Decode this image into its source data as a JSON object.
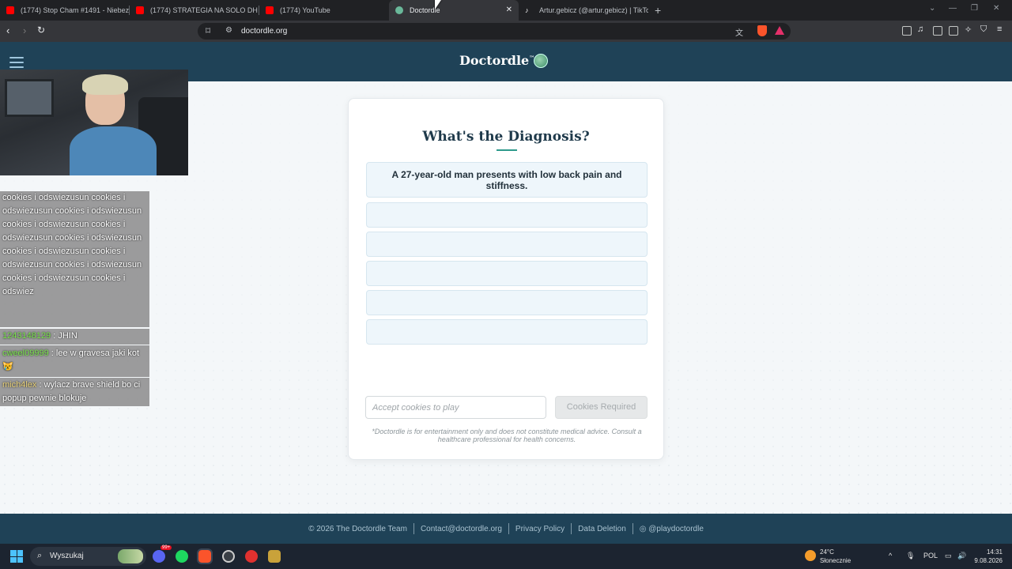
{
  "browser": {
    "tabs": [
      {
        "title": "(1774) Stop Cham #1491 - Niebezpie",
        "icon": "youtube-icon",
        "color": "#ff0000"
      },
      {
        "title": "(1774) STRATEGIA NA SOLO DH JEST",
        "icon": "youtube-icon",
        "color": "#ff0000"
      },
      {
        "title": "(1774) YouTube",
        "icon": "youtube-icon",
        "color": "#ff0000"
      },
      {
        "title": "Doctordle",
        "icon": "globe-icon",
        "color": "#6ab89a",
        "active": true
      },
      {
        "title": "Artur.gebicz (@artur.gebicz) | TikTok",
        "icon": "tiktok-icon",
        "color": "#ffffff"
      }
    ],
    "new_tab": "+",
    "url": "doctordle.org"
  },
  "site": {
    "logo": "Doctordle",
    "logo_tm": "™",
    "heading": "What's the Diagnosis?",
    "clues": [
      "A 27-year-old man presents with low back pain and stiffness.",
      "",
      "",
      "",
      "",
      ""
    ],
    "input_placeholder": "Accept cookies to play",
    "submit_label": "Cookies Required",
    "disclaimer": "*Doctordle is for entertainment only and does not constitute medical advice. Consult a healthcare professional for health concerns.",
    "accent": "#2e9a8c"
  },
  "footer": {
    "copyright": "© 2026 The Doctordle Team",
    "contact": "Contact@doctordle.org",
    "privacy": "Privacy Policy",
    "deletion": "Data Deletion",
    "instagram": "◎ @playdoctordle"
  },
  "chat": [
    {
      "user": "",
      "text": "cookies i odswiezusun cookies i odswiezusun cookies i odswiezusun cookies i odswiezusun cookies i odswiezusun cookies i odswiezusun cookies i odswiezusun cookies i odswiezusun cookies i odswiezusun cookies i odswiezusun cookies i odswiez"
    },
    {
      "user": "1243148129",
      "text": " : JHIN"
    },
    {
      "user": "cweel09999",
      "text": " : lee w gravesa jaki kot 😿"
    },
    {
      "user": "mich4lex",
      "text": " : wylacz brave shield bo ci popup pewnie blokuje"
    }
  ],
  "taskbar": {
    "search": "Wyszukaj",
    "badge": "99+",
    "weather_temp": "24°C",
    "weather_desc": "Słonecznie",
    "lang": "POL",
    "time": "14:31",
    "date": "9.08.2026"
  }
}
